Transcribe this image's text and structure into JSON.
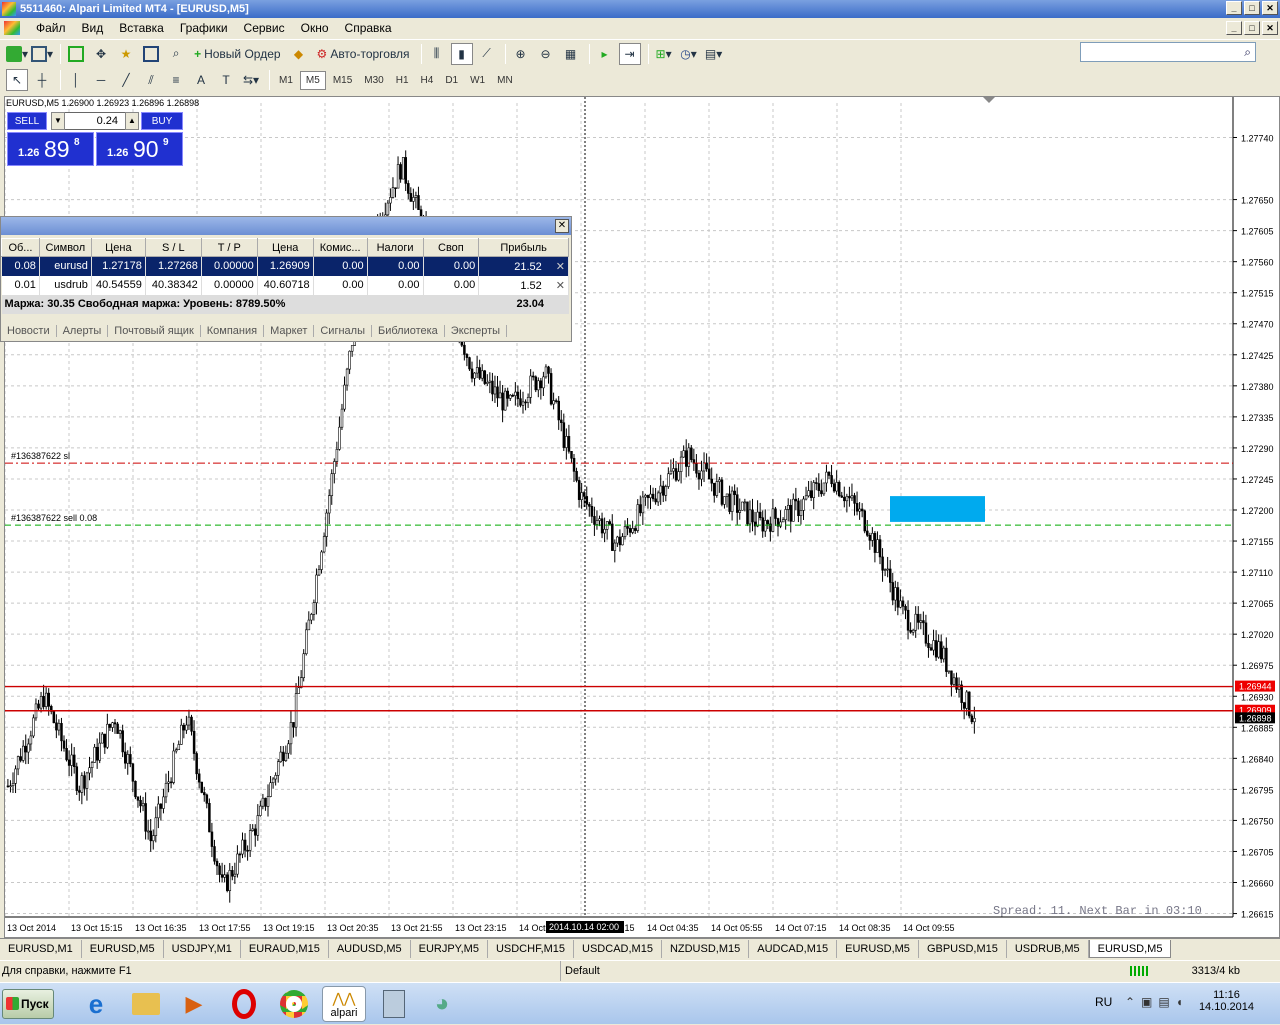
{
  "window": {
    "title": "5511460: Alpari Limited MT4 - [EURUSD,M5]"
  },
  "menu": [
    "Файл",
    "Вид",
    "Вставка",
    "Графики",
    "Сервис",
    "Окно",
    "Справка"
  ],
  "toolbar": {
    "new_order": "Новый Ордер",
    "autotrading": "Авто-торговля"
  },
  "timeframes": [
    "M1",
    "M5",
    "M15",
    "M30",
    "H1",
    "H4",
    "D1",
    "W1",
    "MN"
  ],
  "active_timeframe": "M5",
  "chart_header": "EURUSD,M5  1.26900 1.26923 1.26896 1.26898",
  "one_click": {
    "sell_label": "SELL",
    "buy_label": "BUY",
    "lot": "0.24",
    "sell_pre": "1.26",
    "sell_big": "89",
    "sell_sup": "8",
    "buy_pre": "1.26",
    "buy_big": "90",
    "buy_sup": "9"
  },
  "terminal": {
    "columns": [
      "Об...",
      "Символ",
      "Цена",
      "S / L",
      "T / P",
      "Цена",
      "Комис...",
      "Налоги",
      "Своп",
      "Прибыль"
    ],
    "rows": [
      [
        "0.08",
        "eurusd",
        "1.27178",
        "1.27268",
        "0.00000",
        "1.26909",
        "0.00",
        "0.00",
        "0.00",
        "21.52"
      ],
      [
        "0.01",
        "usdrub",
        "40.54559",
        "40.38342",
        "0.00000",
        "40.60718",
        "0.00",
        "0.00",
        "0.00",
        "1.52"
      ]
    ],
    "summary": "Маржа: 30.35  Свободная маржа:           Уровень: 8789.50%",
    "summary_profit": "23.04",
    "tabs": [
      "Новости",
      "Алерты",
      "Почтовый ящик",
      "Компания",
      "Маркет",
      "Сигналы",
      "Библиотека",
      "Эксперты"
    ]
  },
  "chart_data": {
    "type": "candlestick",
    "symbol": "EURUSD",
    "timeframe": "M5",
    "y_ticks": [
      "1.27740",
      "1.27650",
      "1.27605",
      "1.27560",
      "1.27515",
      "1.27470",
      "1.27425",
      "1.27380",
      "1.27335",
      "1.27290",
      "1.27245",
      "1.27200",
      "1.27155",
      "1.27110",
      "1.27065",
      "1.27020",
      "1.26975",
      "1.26930",
      "1.26885",
      "1.26840",
      "1.26795",
      "1.26750",
      "1.26705",
      "1.26660",
      "1.26615"
    ],
    "ylim": [
      1.2661,
      1.2779
    ],
    "x_ticks": [
      "13 Oct 2014",
      "13 Oct 15:15",
      "13 Oct 16:35",
      "13 Oct 17:55",
      "13 Oct 19:15",
      "13 Oct 20:35",
      "13 Oct 21:55",
      "13 Oct 23:15",
      "14 Oct",
      "14 Oct 03:15",
      "14 Oct 04:35",
      "14 Oct 05:55",
      "14 Oct 07:15",
      "14 Oct 08:35",
      "14 Oct 09:55"
    ],
    "crosshair_time": "2014.10.14 02:00",
    "close_anchors": [
      1.268,
      1.2693,
      1.268,
      1.269,
      1.2672,
      1.269,
      1.2665,
      1.2675,
      1.269,
      1.2723,
      1.2758,
      1.277,
      1.2755,
      1.274,
      1.2735,
      1.274,
      1.2722,
      1.2715,
      1.2722,
      1.2728,
      1.2722,
      1.2718,
      1.272,
      1.2725,
      1.2718,
      1.2705,
      1.27,
      1.26898
    ],
    "lines": [
      {
        "label": "#136387622 sl",
        "price": 1.27268,
        "color": "#cc0000",
        "style": "dashdot"
      },
      {
        "label": "#136387622 sell 0.08",
        "price": 1.27178,
        "color": "#00aa00",
        "style": "dashed"
      },
      {
        "label": "",
        "price": 1.26944,
        "color": "#cc0000",
        "style": "solid",
        "tag": "1.26944"
      },
      {
        "label": "",
        "price": 1.26909,
        "color": "#cc0000",
        "style": "solid",
        "tag": "1.26909"
      }
    ],
    "current_price": "1.26898",
    "rect": {
      "price_top": 1.2721,
      "price_bottom": 1.2719,
      "color": "#00aaee"
    },
    "spread_text": "Spread: 11. Next Bar in 03:10"
  },
  "chart_tabs": [
    "EURUSD,M1",
    "EURUSD,M5",
    "USDJPY,M1",
    "EURAUD,M15",
    "AUDUSD,M5",
    "EURJPY,M5",
    "USDCHF,M15",
    "USDCAD,M15",
    "NZDUSD,M15",
    "AUDCAD,M15",
    "EURUSD,M5",
    "GBPUSD,M15",
    "USDRUB,M5",
    "EURUSD,M5"
  ],
  "active_chart_tab": 13,
  "status": {
    "help": "Для справки, нажмите F1",
    "profile": "Default",
    "traffic": "3313/4 kb"
  },
  "taskbar": {
    "start": "Пуск",
    "alpari": "alpari",
    "lang": "RU",
    "time": "11:16",
    "date": "14.10.2014"
  }
}
